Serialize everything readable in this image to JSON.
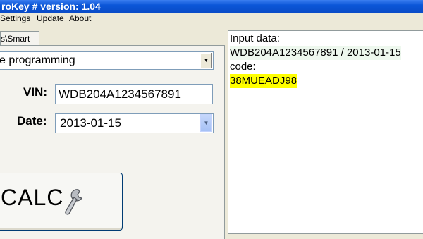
{
  "window": {
    "title": "roKey # version: 1.04"
  },
  "menu": [
    "Settings",
    "Update",
    "About"
  ],
  "tab": {
    "label": "s\\Smart"
  },
  "mode_select": {
    "value": "e programming"
  },
  "vin": {
    "label": "VIN:",
    "value": "WDB204A1234567891"
  },
  "date": {
    "label": "Date:",
    "value": "2013-01-15"
  },
  "calc_button": {
    "label": "CALC"
  },
  "output": {
    "input_label": "Input data:",
    "input_value": "WDB204A1234567891 / 2013-01-15",
    "code_label": "code:",
    "code_value": "38MUEADJ98"
  },
  "colors": {
    "titlebar": "#0b56d8",
    "code_highlight": "#ffff00",
    "input_highlight": "#eef8ee"
  }
}
